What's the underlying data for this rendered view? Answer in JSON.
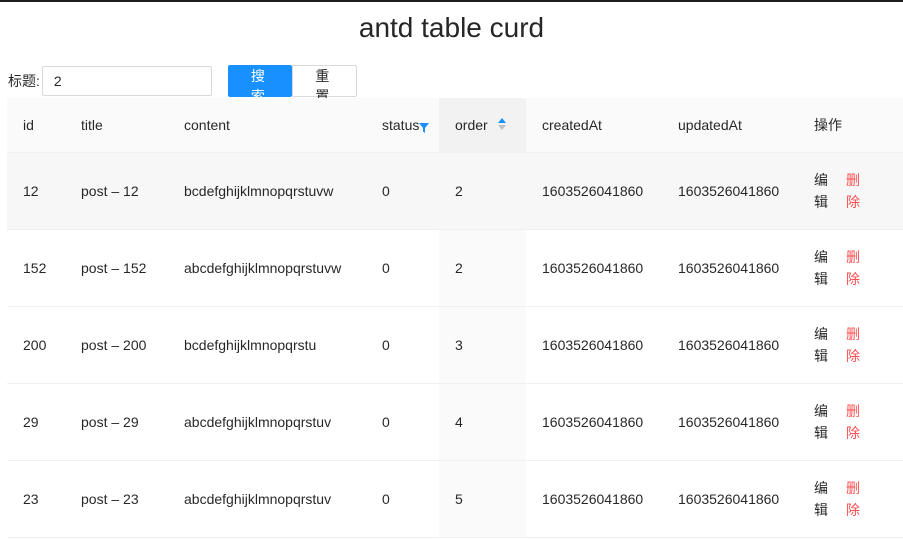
{
  "title": "antd table curd",
  "search": {
    "label": "标题:",
    "value": "2",
    "submit_label": "搜索",
    "reset_label": "重置"
  },
  "table": {
    "columns": {
      "id": "id",
      "title": "title",
      "content": "content",
      "status": "status",
      "order": "order",
      "createdAt": "createdAt",
      "updatedAt": "updatedAt",
      "actions": "操作"
    },
    "rows": [
      {
        "id": "12",
        "title": "post – 12",
        "content": "bcdefghijklmnopqrstuvw",
        "status": "0",
        "order": "2",
        "createdAt": "1603526041860",
        "updatedAt": "1603526041860",
        "edit": "编辑",
        "delete": "删除"
      },
      {
        "id": "152",
        "title": "post – 152",
        "content": "abcdefghijklmnopqrstuvw",
        "status": "0",
        "order": "2",
        "createdAt": "1603526041860",
        "updatedAt": "1603526041860",
        "edit": "编辑",
        "delete": "删除"
      },
      {
        "id": "200",
        "title": "post – 200",
        "content": "bcdefghijklmnopqrstu",
        "status": "0",
        "order": "3",
        "createdAt": "1603526041860",
        "updatedAt": "1603526041860",
        "edit": "编辑",
        "delete": "删除"
      },
      {
        "id": "29",
        "title": "post – 29",
        "content": "abcdefghijklmnopqrstuv",
        "status": "0",
        "order": "4",
        "createdAt": "1603526041860",
        "updatedAt": "1603526041860",
        "edit": "编辑",
        "delete": "删除"
      },
      {
        "id": "23",
        "title": "post – 23",
        "content": "abcdefghijklmnopqrstuv",
        "status": "0",
        "order": "5",
        "createdAt": "1603526041860",
        "updatedAt": "1603526041860",
        "edit": "编辑",
        "delete": "删除"
      }
    ]
  },
  "colors": {
    "primary": "#1890ff",
    "danger": "#ff4d4f"
  },
  "icons": {
    "status_filter": "filter-icon",
    "order_sort": "sort-ascending-icon"
  }
}
